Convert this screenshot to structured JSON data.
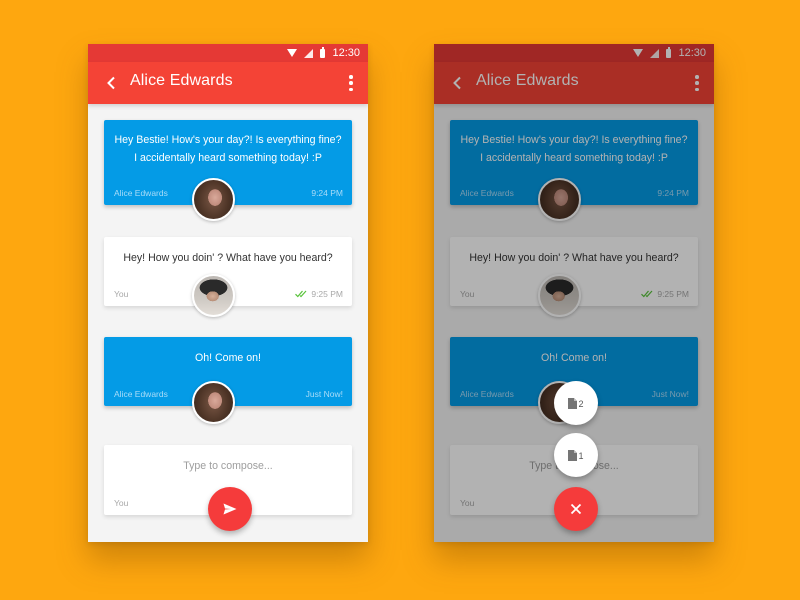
{
  "status_bar": {
    "time": "12:30"
  },
  "conversation": {
    "title": "Alice Edwards",
    "messages": [
      {
        "text": "Hey Bestie! How's your day?! Is everything fine?\nI accidentally heard something today! :P",
        "sender": "Alice Edwards",
        "time": "9:24 PM",
        "style": "incoming"
      },
      {
        "text": "Hey! How you doin' ? What have you heard?",
        "sender": "You",
        "time": "9:25 PM",
        "style": "outgoing",
        "read": true
      },
      {
        "text": "Oh! Come on!",
        "sender": "Alice Edwards",
        "time": "Just Now!",
        "style": "incoming"
      }
    ],
    "compose": {
      "placeholder": "Type to compose...",
      "sender": "You"
    }
  },
  "fab_menu": {
    "items": [
      {
        "icon": "document-icon",
        "badge": "2"
      },
      {
        "icon": "document-icon",
        "badge": "1"
      }
    ],
    "close_icon": "close-icon"
  },
  "colors": {
    "background": "#fea70f",
    "status_bar": "#e53935",
    "app_bar": "#f44336",
    "incoming_card": "#049be6",
    "fab": "#f53b3b",
    "read_check": "#58c33a"
  }
}
